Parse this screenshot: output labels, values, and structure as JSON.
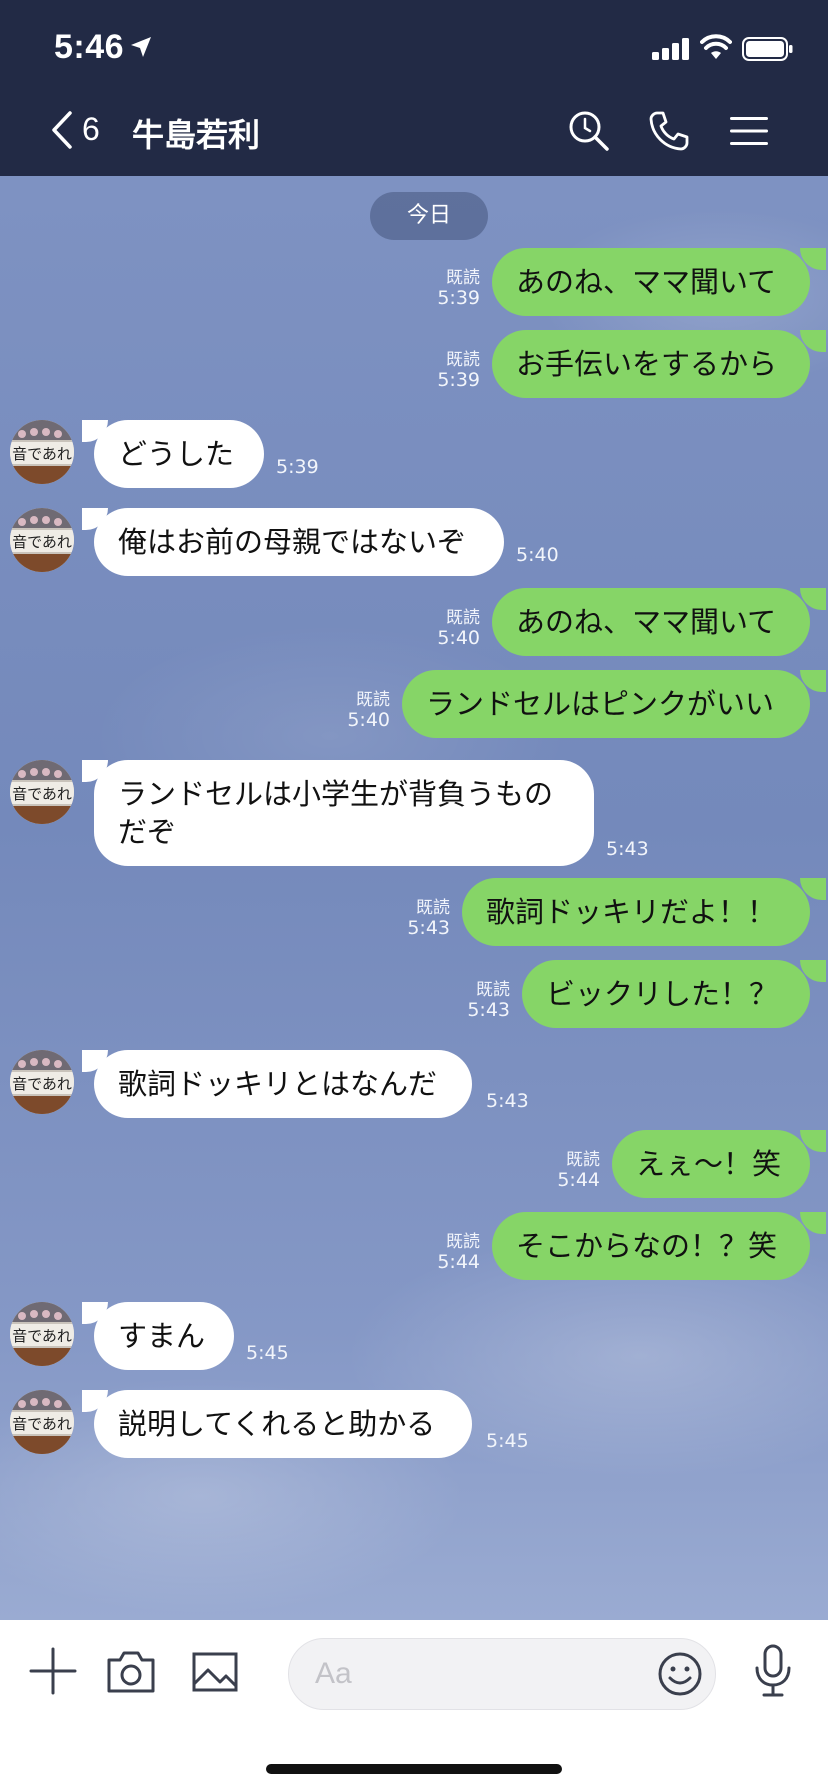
{
  "status_bar": {
    "time": "5:46"
  },
  "header": {
    "unread_count": "6",
    "chat_name": "牛島若利"
  },
  "date_separator": "今日",
  "messages": [
    {
      "side": "out",
      "text": "あのね、ママ聞いて",
      "read": "既読",
      "time": "5:39"
    },
    {
      "side": "out",
      "text": "お手伝いをするから",
      "read": "既読",
      "time": "5:39"
    },
    {
      "side": "in",
      "text": "どうした",
      "time": "5:39"
    },
    {
      "side": "in",
      "text": "俺はお前の母親ではないぞ",
      "time": "5:40"
    },
    {
      "side": "out",
      "text": "あのね、ママ聞いて",
      "read": "既読",
      "time": "5:40"
    },
    {
      "side": "out",
      "text": "ランドセルはピンクがいい",
      "read": "既読",
      "time": "5:40"
    },
    {
      "side": "in",
      "text": "ランドセルは小学生が背負うものだぞ",
      "time": "5:43"
    },
    {
      "side": "out",
      "text": "歌詞ドッキリだよ！！",
      "read": "既読",
      "time": "5:43"
    },
    {
      "side": "out",
      "text": "ビックリした！？",
      "read": "既読",
      "time": "5:43"
    },
    {
      "side": "in",
      "text": "歌詞ドッキリとはなんだ",
      "time": "5:43"
    },
    {
      "side": "out",
      "text": "えぇ〜！笑",
      "read": "既読",
      "time": "5:44"
    },
    {
      "side": "out",
      "text": "そこからなの！？笑",
      "read": "既読",
      "time": "5:44"
    },
    {
      "side": "in",
      "text": "すまん",
      "time": "5:45"
    },
    {
      "side": "in",
      "text": "説明してくれると助かる",
      "time": "5:45"
    }
  ],
  "avatar_text": "音であれ",
  "input": {
    "placeholder": "Aa"
  },
  "colors": {
    "header_bg": "#222a45",
    "outgoing_bubble": "#86d567",
    "incoming_bubble": "#ffffff",
    "chat_bg": "#7b90c0"
  }
}
